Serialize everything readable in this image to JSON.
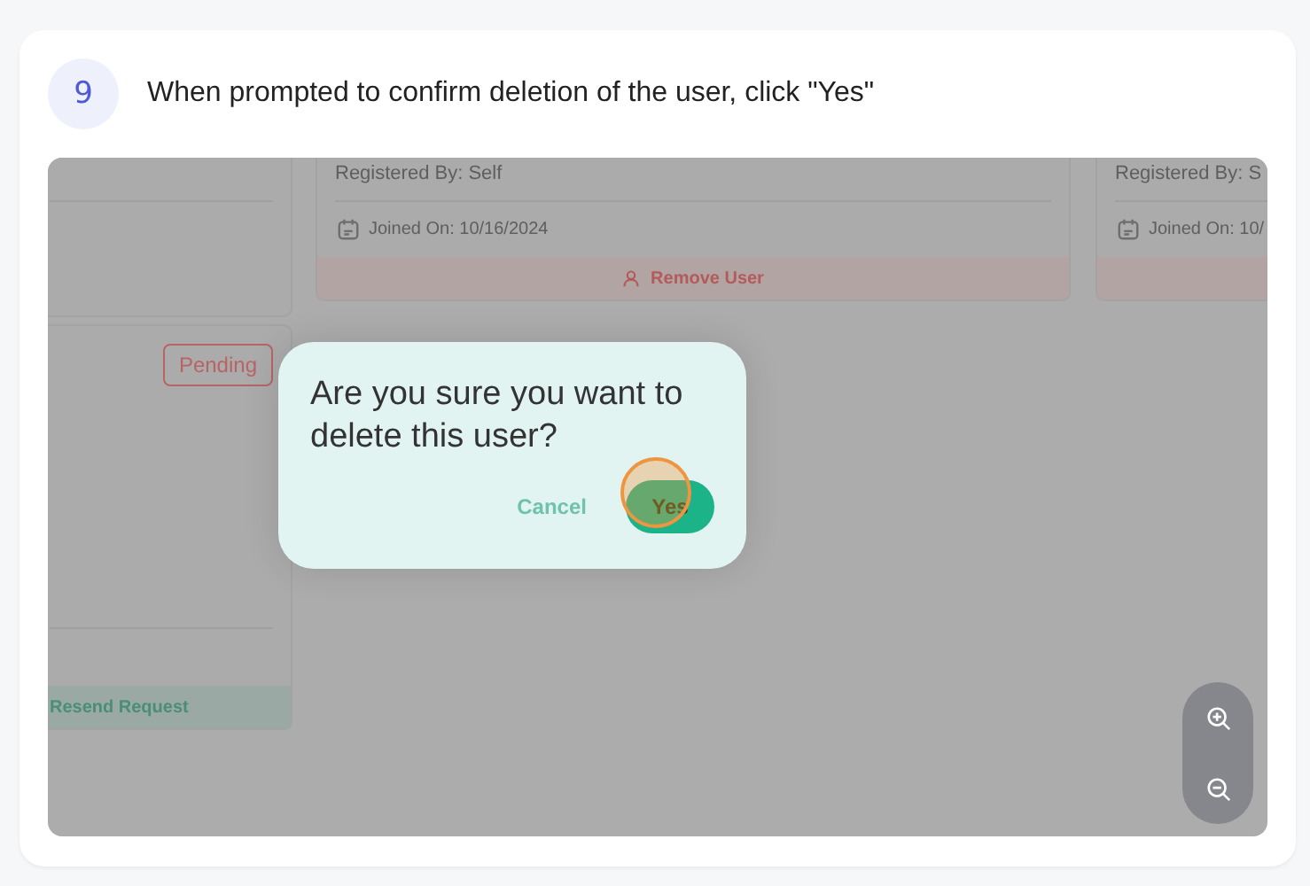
{
  "step": {
    "number": "9",
    "instruction": "When prompted to confirm deletion of the user, click \"Yes\""
  },
  "screenshot": {
    "member_cards": [
      {
        "registered_by": "Registered By: Self",
        "joined_on": "Joined On: 10/16/2024",
        "action": "Remove User"
      },
      {
        "registered_by": "Registered By: S",
        "joined_on": "Joined On: 10/"
      }
    ],
    "invite_card": {
      "status": "Pending",
      "action": "Resend Request"
    },
    "dialog": {
      "question": "Are you sure you want to delete this user?",
      "buttons": [
        {
          "label": "Cancel",
          "kind": "text",
          "highlighted": false
        },
        {
          "label": "Yes",
          "kind": "primary",
          "highlighted": true
        }
      ]
    }
  }
}
